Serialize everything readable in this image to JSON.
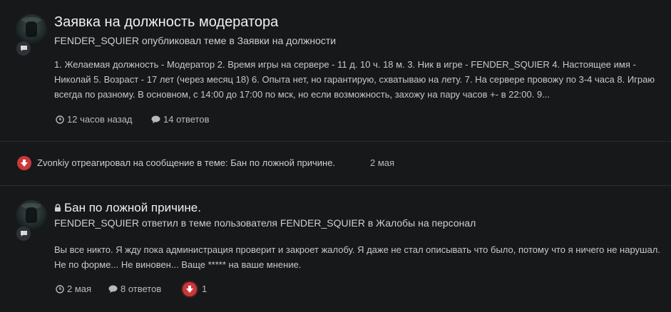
{
  "post1": {
    "title": "Заявка на должность модератора",
    "meta": "FENDER_SQUIER опубликовал теме в Заявки на должности",
    "body": "1. Желаемая должность - Модератор 2. Время игры на сервере - 11 д. 10 ч. 18 м. 3. Ник в игре - FENDER_SQUIER 4. Настоящее имя - Николай 5. Возраст - 17 лет (через месяц 18) 6. Опыта нет, но гарантирую, схватываю на лету. 7. На сервере провожу по 3-4 часа 8. Играю всегда по разному. В основном, с 14:00 до 17:00 по мск, но если возможность, захожу на пару часов +- в 22:00. 9...",
    "time": "12 часов назад",
    "replies": "14 ответов"
  },
  "reaction": {
    "text": "Zvonkiy отреагировал на сообщение в теме: Бан по ложной причине.",
    "date": "2 мая"
  },
  "post2": {
    "title": "Бан по ложной причине.",
    "meta": "FENDER_SQUIER ответил в теме пользователя FENDER_SQUIER в Жалобы на персонал",
    "body": "Вы все никто. Я жду пока администрация проверит и закроет жалобу. Я даже не стал описывать что было, потому что я ничего не нарушал. Не по форме... Не виновен... Ваще ***** на ваше мнение.",
    "time": "2 мая",
    "replies": "8 ответов",
    "reaction_count": "1"
  },
  "colors": {
    "background": "#17181a",
    "reaction_red": "#c9383a"
  },
  "icons": [
    "chat-bubble-icon",
    "clock-icon",
    "comment-icon",
    "thumbs-down-icon",
    "lock-icon"
  ]
}
